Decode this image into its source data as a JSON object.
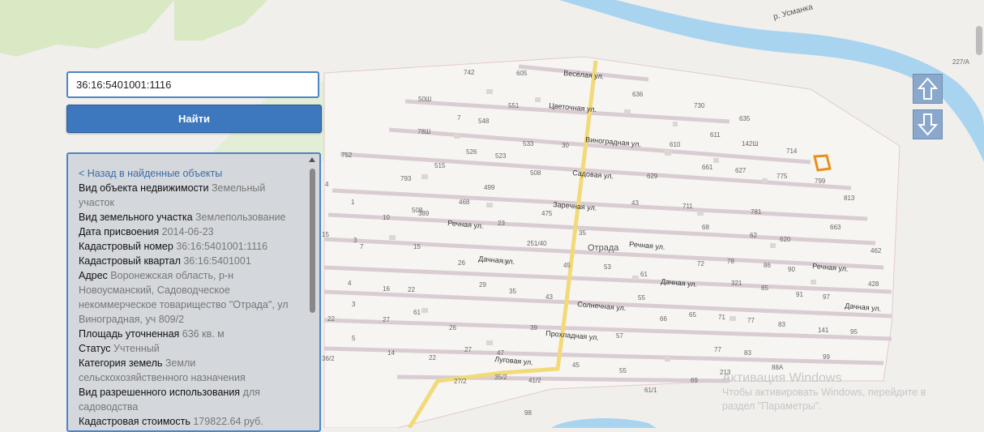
{
  "search": {
    "value": "36:16:5401001:1116",
    "button": "Найти"
  },
  "info": {
    "back": "< Назад в найденные объекты",
    "rows": [
      {
        "label": "Вид объекта недвижимости",
        "value": "Земельный участок"
      },
      {
        "label": "Вид земельного участка",
        "value": "Землепользование"
      },
      {
        "label": "Дата присвоения",
        "value": "2014-06-23"
      },
      {
        "label": "Кадастровый номер",
        "value": "36:16:5401001:1116"
      },
      {
        "label": "Кадастровый квартал",
        "value": "36:16:5401001"
      },
      {
        "label": "Адрес",
        "value": "Воронежская область, р-н Новоусманский, Садоводческое некоммерческое товарищество \"Отрада\", ул Виноградная, уч 809/2"
      },
      {
        "label": "Площадь уточненная",
        "value": "636 кв. м"
      },
      {
        "label": "Статус",
        "value": "Учтенный"
      },
      {
        "label": "Категория земель",
        "value": "Земли сельскохозяйственного назначения"
      },
      {
        "label": "Вид разрешенного использования",
        "value": "для садоводства"
      },
      {
        "label": "Кадастровая стоимость",
        "value": "179822.64 руб."
      }
    ]
  },
  "map": {
    "river": "р. Усманка",
    "place": "Отрада",
    "streets": [
      "Весёлая ул.",
      "Цветочная ул.",
      "Виноградная ул.",
      "Садовая ул.",
      "Заречная ул.",
      "Речная ул.",
      "Речная ул.",
      "Речная ул.",
      "Дачная ул.",
      "Дачная ул.",
      "Дачная ул.",
      "Солнечная ул.",
      "Прохладная ул.",
      "Луговая ул."
    ],
    "numbers": [
      "742",
      "605",
      "636",
      "50Ш",
      "551",
      "730",
      "7",
      "548",
      "635",
      "78Ш",
      "533",
      "30",
      "611",
      "526",
      "523",
      "610",
      "142Ш",
      "714",
      "752",
      "515",
      "508",
      "661",
      "627",
      "775",
      "799",
      "4",
      "793",
      "499",
      "629",
      "813",
      "1",
      "468",
      "43",
      "711",
      "781",
      "389",
      "475",
      "508",
      "10",
      "23",
      "68",
      "663",
      "15",
      "35",
      "620",
      "3",
      "251/40",
      "62",
      "462",
      "7",
      "15",
      "72",
      "78",
      "86",
      "90",
      "26",
      "45",
      "53",
      "428",
      "4",
      "29",
      "61",
      "321",
      "85",
      "16",
      "22",
      "35",
      "43",
      "55",
      "91",
      "97",
      "3",
      "61",
      "65",
      "71",
      "77",
      "83",
      "95",
      "22",
      "27",
      "26",
      "39",
      "57",
      "66",
      "141",
      "5",
      "27",
      "47",
      "77",
      "83",
      "99",
      "36/2",
      "14",
      "22",
      "88А",
      "45",
      "55",
      "61/1",
      "27/2",
      "35/2",
      "41/2",
      "69",
      "213",
      "98",
      "227/А"
    ],
    "parcel_color": "#e8901c"
  },
  "nav": {
    "up": "arrow-up-icon",
    "down": "arrow-down-icon"
  },
  "watermark": {
    "title": "Активация Windows",
    "line1": "Чтобы активировать Windows, перейдите в",
    "line2": "раздел \"Параметры\"."
  }
}
